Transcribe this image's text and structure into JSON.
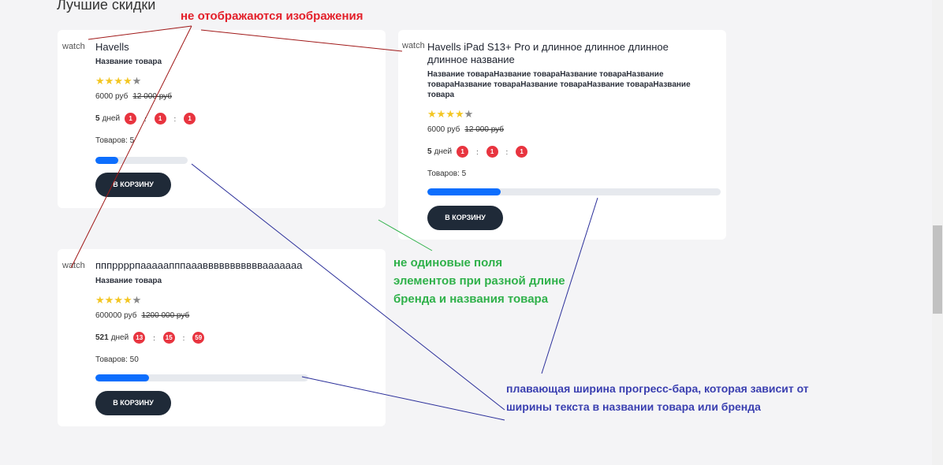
{
  "section_title": "Лучшие скидки",
  "products": [
    {
      "img_alt": "watch",
      "brand": "Havells",
      "name": "Название товара",
      "rating_filled": 4,
      "rating_total": 5,
      "price": "6000 руб",
      "old_price": "12 000 руб",
      "timer": {
        "days": "5",
        "days_label": "дней",
        "hours": "1",
        "minutes": "1",
        "seconds": "1",
        "sep": ":"
      },
      "stock": "Товаров: 5",
      "progress_fraction": 0.25,
      "cart_label": "В КОРЗИНУ"
    },
    {
      "img_alt": "watch",
      "brand": "Havells iPad S13+ Pro и длинное длинное длинное длинное название",
      "name": "Название товараНазвание товараНазвание товараНазвание товараНазвание товараНазвание товараНазвание товараНазвание товара",
      "rating_filled": 4,
      "rating_total": 5,
      "price": "6000 руб",
      "old_price": "12 000 руб",
      "timer": {
        "days": "5",
        "days_label": "дней",
        "hours": "1",
        "minutes": "1",
        "seconds": "1",
        "sep": ":"
      },
      "stock": "Товаров: 5",
      "progress_fraction": 0.25,
      "cart_label": "В КОРЗИНУ"
    },
    {
      "img_alt": "watch",
      "brand": "пппррррпааааапппааавввввввввввааааааа",
      "name": "Название товара",
      "rating_filled": 4,
      "rating_total": 5,
      "price": "600000 руб",
      "old_price": "1200 000 руб",
      "timer": {
        "days": "521",
        "days_label": "дней",
        "hours": "13",
        "minutes": "15",
        "seconds": "59",
        "sep": ":"
      },
      "stock": "Товаров: 50",
      "progress_fraction": 0.25,
      "cart_label": "В КОРЗИНУ"
    }
  ],
  "annotations": {
    "images_note": "не отображаются изображения",
    "fields_note": "не одиновые поля элементов при разной длине бренда и названия товара",
    "progress_note": "плавающая ширина прогресс-бара, которая зависит от ширины текста в названии товара или бренда"
  },
  "colors": {
    "accent_blue": "#0d6efd",
    "badge_red": "#e8343f",
    "button_dark": "#1f2a38",
    "star_gold": "#f3c623",
    "note_red": "#e3202a",
    "note_green": "#2fb14a",
    "note_blue": "#3a3fb0"
  }
}
